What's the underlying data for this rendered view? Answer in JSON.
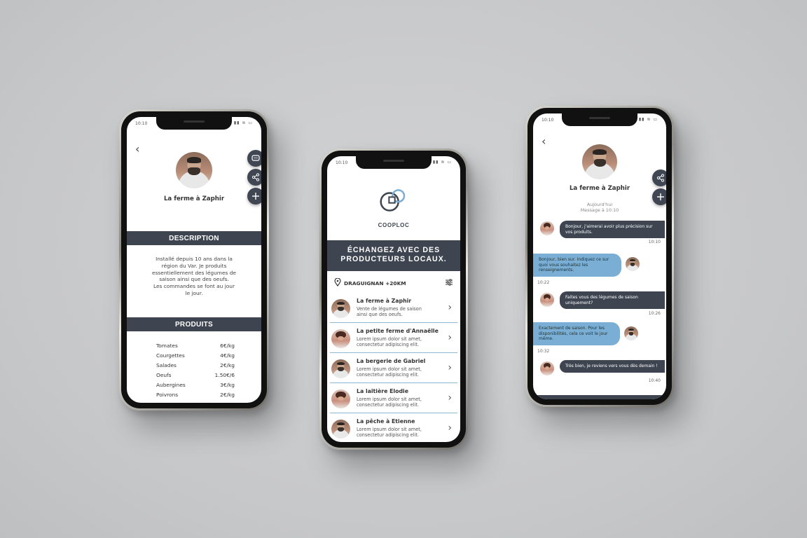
{
  "status_time": "10:10",
  "status_icons": "▮▮ ≋ ▭",
  "left_phone": {
    "producer_name": "La ferme à Zaphir",
    "description_title": "DESCRIPTION",
    "description_lines": [
      "Installé depuis 10 ans dans la",
      "région du Var. Je produits",
      "essentiellement des légumes de",
      "saison ainsi que des oeufs.",
      "Les commandes se font au jour",
      "le jour."
    ],
    "products_title": "PRODUITS",
    "products": [
      {
        "name": "Tomates",
        "price": "6€/kg"
      },
      {
        "name": "Courgettes",
        "price": "4€/kg"
      },
      {
        "name": "Salades",
        "price": "2€/kg"
      },
      {
        "name": "Oeufs",
        "price": "1.50€/6"
      },
      {
        "name": "Aubergines",
        "price": "3€/kg"
      },
      {
        "name": "Poivrons",
        "price": "2€/kg"
      }
    ]
  },
  "middle_phone": {
    "brand": "COOPLOC",
    "hero_line1": "ÉCHANGEZ AVEC DES",
    "hero_line2": "PRODUCTEURS LOCAUX.",
    "location": "DRAGUIGNAN +20KM",
    "producers": [
      {
        "title": "La ferme à Zaphir",
        "sub1": "Vente de légumes de saison",
        "sub2": "ainsi que des oeufs."
      },
      {
        "title": "La petite ferme d'Annaëlle",
        "sub1": "Lorem ipsum dolor sit amet,",
        "sub2": "consectetur adipiscing elit."
      },
      {
        "title": "La bergerie de Gabriel",
        "sub1": "Lorem ipsum dolor sit amet,",
        "sub2": "consectetur adipiscing elit."
      },
      {
        "title": "La laitière Elodie",
        "sub1": "Lorem ipsum dolor sit amet,",
        "sub2": "consectetur adipiscing elit."
      },
      {
        "title": "La pêche à Etienne",
        "sub1": "Lorem ipsum dolor sit amet,",
        "sub2": "consectetur adipiscing elit."
      }
    ]
  },
  "right_phone": {
    "producer_name": "La ferme à Zaphir",
    "day_label": "Aujourd'hui",
    "message_time_label": "Message à 10:10",
    "messages": [
      {
        "text": "Bonjour, j'aimerai avoir plus précision sur vos produits.",
        "time": "10:10"
      },
      {
        "text": "Bonjour, bien sur. Indiquez ce sur quoi vous souhaitez les renseignements.",
        "time": "10:22"
      },
      {
        "text": "Faites vous des légumes de saison uniquement?",
        "time": "10:26"
      },
      {
        "text": "Exactement de saison. Pour les disponibilités, cela ce voit le jour même.",
        "time": "10:32"
      },
      {
        "text": "Très bien, je reviens vers vous dès demain !",
        "time": "10:40"
      }
    ]
  },
  "colors": {
    "dark_bar": "#3e4550",
    "accent_blue": "#7aaed4",
    "background": "#c9cacc"
  }
}
